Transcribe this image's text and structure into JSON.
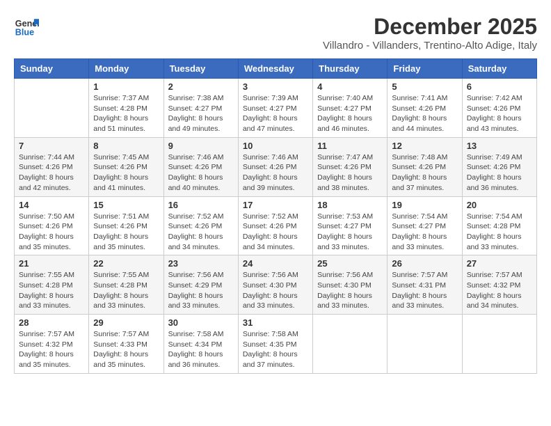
{
  "header": {
    "logo": {
      "line1": "General",
      "line2": "Blue"
    },
    "title": "December 2025",
    "subtitle": "Villandro - Villanders, Trentino-Alto Adige, Italy"
  },
  "weekdays": [
    "Sunday",
    "Monday",
    "Tuesday",
    "Wednesday",
    "Thursday",
    "Friday",
    "Saturday"
  ],
  "weeks": [
    [
      {
        "day": "",
        "sunrise": "",
        "sunset": "",
        "daylight": ""
      },
      {
        "day": "1",
        "sunrise": "Sunrise: 7:37 AM",
        "sunset": "Sunset: 4:28 PM",
        "daylight": "Daylight: 8 hours and 51 minutes."
      },
      {
        "day": "2",
        "sunrise": "Sunrise: 7:38 AM",
        "sunset": "Sunset: 4:27 PM",
        "daylight": "Daylight: 8 hours and 49 minutes."
      },
      {
        "day": "3",
        "sunrise": "Sunrise: 7:39 AM",
        "sunset": "Sunset: 4:27 PM",
        "daylight": "Daylight: 8 hours and 47 minutes."
      },
      {
        "day": "4",
        "sunrise": "Sunrise: 7:40 AM",
        "sunset": "Sunset: 4:27 PM",
        "daylight": "Daylight: 8 hours and 46 minutes."
      },
      {
        "day": "5",
        "sunrise": "Sunrise: 7:41 AM",
        "sunset": "Sunset: 4:26 PM",
        "daylight": "Daylight: 8 hours and 44 minutes."
      },
      {
        "day": "6",
        "sunrise": "Sunrise: 7:42 AM",
        "sunset": "Sunset: 4:26 PM",
        "daylight": "Daylight: 8 hours and 43 minutes."
      }
    ],
    [
      {
        "day": "7",
        "sunrise": "Sunrise: 7:44 AM",
        "sunset": "Sunset: 4:26 PM",
        "daylight": "Daylight: 8 hours and 42 minutes."
      },
      {
        "day": "8",
        "sunrise": "Sunrise: 7:45 AM",
        "sunset": "Sunset: 4:26 PM",
        "daylight": "Daylight: 8 hours and 41 minutes."
      },
      {
        "day": "9",
        "sunrise": "Sunrise: 7:46 AM",
        "sunset": "Sunset: 4:26 PM",
        "daylight": "Daylight: 8 hours and 40 minutes."
      },
      {
        "day": "10",
        "sunrise": "Sunrise: 7:46 AM",
        "sunset": "Sunset: 4:26 PM",
        "daylight": "Daylight: 8 hours and 39 minutes."
      },
      {
        "day": "11",
        "sunrise": "Sunrise: 7:47 AM",
        "sunset": "Sunset: 4:26 PM",
        "daylight": "Daylight: 8 hours and 38 minutes."
      },
      {
        "day": "12",
        "sunrise": "Sunrise: 7:48 AM",
        "sunset": "Sunset: 4:26 PM",
        "daylight": "Daylight: 8 hours and 37 minutes."
      },
      {
        "day": "13",
        "sunrise": "Sunrise: 7:49 AM",
        "sunset": "Sunset: 4:26 PM",
        "daylight": "Daylight: 8 hours and 36 minutes."
      }
    ],
    [
      {
        "day": "14",
        "sunrise": "Sunrise: 7:50 AM",
        "sunset": "Sunset: 4:26 PM",
        "daylight": "Daylight: 8 hours and 35 minutes."
      },
      {
        "day": "15",
        "sunrise": "Sunrise: 7:51 AM",
        "sunset": "Sunset: 4:26 PM",
        "daylight": "Daylight: 8 hours and 35 minutes."
      },
      {
        "day": "16",
        "sunrise": "Sunrise: 7:52 AM",
        "sunset": "Sunset: 4:26 PM",
        "daylight": "Daylight: 8 hours and 34 minutes."
      },
      {
        "day": "17",
        "sunrise": "Sunrise: 7:52 AM",
        "sunset": "Sunset: 4:26 PM",
        "daylight": "Daylight: 8 hours and 34 minutes."
      },
      {
        "day": "18",
        "sunrise": "Sunrise: 7:53 AM",
        "sunset": "Sunset: 4:27 PM",
        "daylight": "Daylight: 8 hours and 33 minutes."
      },
      {
        "day": "19",
        "sunrise": "Sunrise: 7:54 AM",
        "sunset": "Sunset: 4:27 PM",
        "daylight": "Daylight: 8 hours and 33 minutes."
      },
      {
        "day": "20",
        "sunrise": "Sunrise: 7:54 AM",
        "sunset": "Sunset: 4:28 PM",
        "daylight": "Daylight: 8 hours and 33 minutes."
      }
    ],
    [
      {
        "day": "21",
        "sunrise": "Sunrise: 7:55 AM",
        "sunset": "Sunset: 4:28 PM",
        "daylight": "Daylight: 8 hours and 33 minutes."
      },
      {
        "day": "22",
        "sunrise": "Sunrise: 7:55 AM",
        "sunset": "Sunset: 4:28 PM",
        "daylight": "Daylight: 8 hours and 33 minutes."
      },
      {
        "day": "23",
        "sunrise": "Sunrise: 7:56 AM",
        "sunset": "Sunset: 4:29 PM",
        "daylight": "Daylight: 8 hours and 33 minutes."
      },
      {
        "day": "24",
        "sunrise": "Sunrise: 7:56 AM",
        "sunset": "Sunset: 4:30 PM",
        "daylight": "Daylight: 8 hours and 33 minutes."
      },
      {
        "day": "25",
        "sunrise": "Sunrise: 7:56 AM",
        "sunset": "Sunset: 4:30 PM",
        "daylight": "Daylight: 8 hours and 33 minutes."
      },
      {
        "day": "26",
        "sunrise": "Sunrise: 7:57 AM",
        "sunset": "Sunset: 4:31 PM",
        "daylight": "Daylight: 8 hours and 33 minutes."
      },
      {
        "day": "27",
        "sunrise": "Sunrise: 7:57 AM",
        "sunset": "Sunset: 4:32 PM",
        "daylight": "Daylight: 8 hours and 34 minutes."
      }
    ],
    [
      {
        "day": "28",
        "sunrise": "Sunrise: 7:57 AM",
        "sunset": "Sunset: 4:32 PM",
        "daylight": "Daylight: 8 hours and 35 minutes."
      },
      {
        "day": "29",
        "sunrise": "Sunrise: 7:57 AM",
        "sunset": "Sunset: 4:33 PM",
        "daylight": "Daylight: 8 hours and 35 minutes."
      },
      {
        "day": "30",
        "sunrise": "Sunrise: 7:58 AM",
        "sunset": "Sunset: 4:34 PM",
        "daylight": "Daylight: 8 hours and 36 minutes."
      },
      {
        "day": "31",
        "sunrise": "Sunrise: 7:58 AM",
        "sunset": "Sunset: 4:35 PM",
        "daylight": "Daylight: 8 hours and 37 minutes."
      },
      {
        "day": "",
        "sunrise": "",
        "sunset": "",
        "daylight": ""
      },
      {
        "day": "",
        "sunrise": "",
        "sunset": "",
        "daylight": ""
      },
      {
        "day": "",
        "sunrise": "",
        "sunset": "",
        "daylight": ""
      }
    ]
  ]
}
